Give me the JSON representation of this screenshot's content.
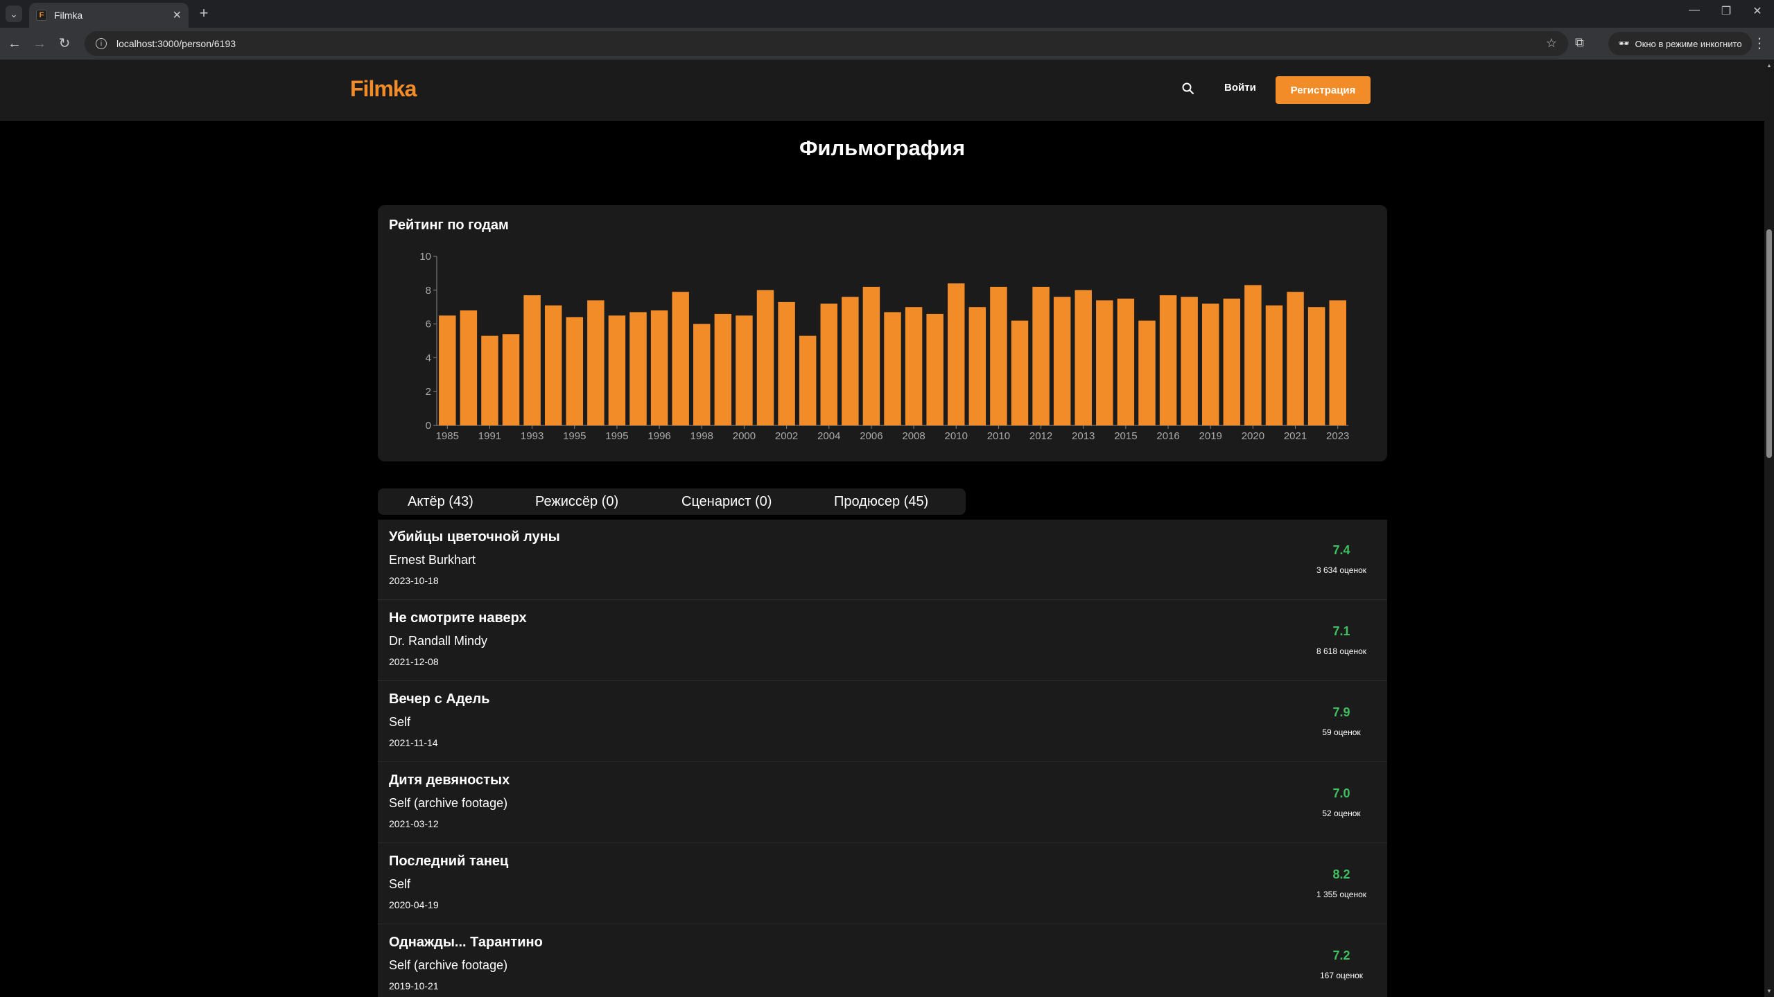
{
  "browser": {
    "tab_title": "Filmka",
    "tab_favicon": "F",
    "url": "localhost:3000/person/6193",
    "incognito_label": "Окно в режиме инкогнито",
    "icons": [
      "tab-list-icon",
      "close-icon",
      "new-tab-icon",
      "minimize-icon",
      "restore-icon",
      "close-window-icon",
      "back-icon",
      "forward-icon",
      "reload-icon",
      "site-info-icon",
      "bookmark-star-icon",
      "extensions-icon",
      "incognito-icon",
      "menu-icon"
    ]
  },
  "header": {
    "logo": "Filmka",
    "login_label": "Войти",
    "register_label": "Регистрация",
    "accent_color": "#f28c28"
  },
  "page": {
    "heading": "Фильмография"
  },
  "chart_data": {
    "type": "bar",
    "title": "Рейтинг по годам",
    "xlabel": "",
    "ylabel": "",
    "ylim": [
      0,
      10
    ],
    "yticks": [
      0,
      2,
      4,
      6,
      8,
      10
    ],
    "color": "#f28c28",
    "tick_labels": [
      "1985",
      "1991",
      "1993",
      "1995",
      "1995",
      "1996",
      "1998",
      "2000",
      "2002",
      "2004",
      "2006",
      "2008",
      "2010",
      "2010",
      "2012",
      "2013",
      "2015",
      "2016",
      "2019",
      "2020",
      "2021",
      "2023"
    ],
    "values": [
      6.5,
      6.8,
      5.3,
      5.4,
      7.7,
      7.1,
      6.4,
      7.4,
      6.5,
      6.7,
      6.8,
      7.9,
      6.0,
      6.6,
      6.5,
      8.0,
      7.3,
      5.3,
      7.2,
      7.6,
      8.2,
      6.7,
      7.0,
      6.6,
      8.4,
      7.0,
      8.2,
      6.2,
      8.2,
      7.6,
      8.0,
      7.4,
      7.5,
      6.2,
      7.7,
      7.6,
      7.2,
      7.5,
      8.3,
      7.1,
      7.9,
      7.0,
      7.4
    ]
  },
  "role_tabs": [
    {
      "label": "Актёр (43)"
    },
    {
      "label": "Режиссёр (0)"
    },
    {
      "label": "Сценарист (0)"
    },
    {
      "label": "Продюсер (45)"
    }
  ],
  "films": [
    {
      "title": "Убийцы цветочной луны",
      "role": "Ernest Burkhart",
      "date": "2023-10-18",
      "rating": "7.4",
      "votes": "3 634 оценок"
    },
    {
      "title": "Не смотрите наверх",
      "role": "Dr. Randall Mindy",
      "date": "2021-12-08",
      "rating": "7.1",
      "votes": "8 618 оценок"
    },
    {
      "title": "Вечер с Адель",
      "role": "Self",
      "date": "2021-11-14",
      "rating": "7.9",
      "votes": "59 оценок"
    },
    {
      "title": "Дитя девяностых",
      "role": "Self (archive footage)",
      "date": "2021-03-12",
      "rating": "7.0",
      "votes": "52 оценок"
    },
    {
      "title": "Последний танец",
      "role": "Self",
      "date": "2020-04-19",
      "rating": "8.2",
      "votes": "1 355 оценок"
    },
    {
      "title": "Однажды... Тарантино",
      "role": "Self (archive footage)",
      "date": "2019-10-21",
      "rating": "7.2",
      "votes": "167 оценок"
    }
  ]
}
